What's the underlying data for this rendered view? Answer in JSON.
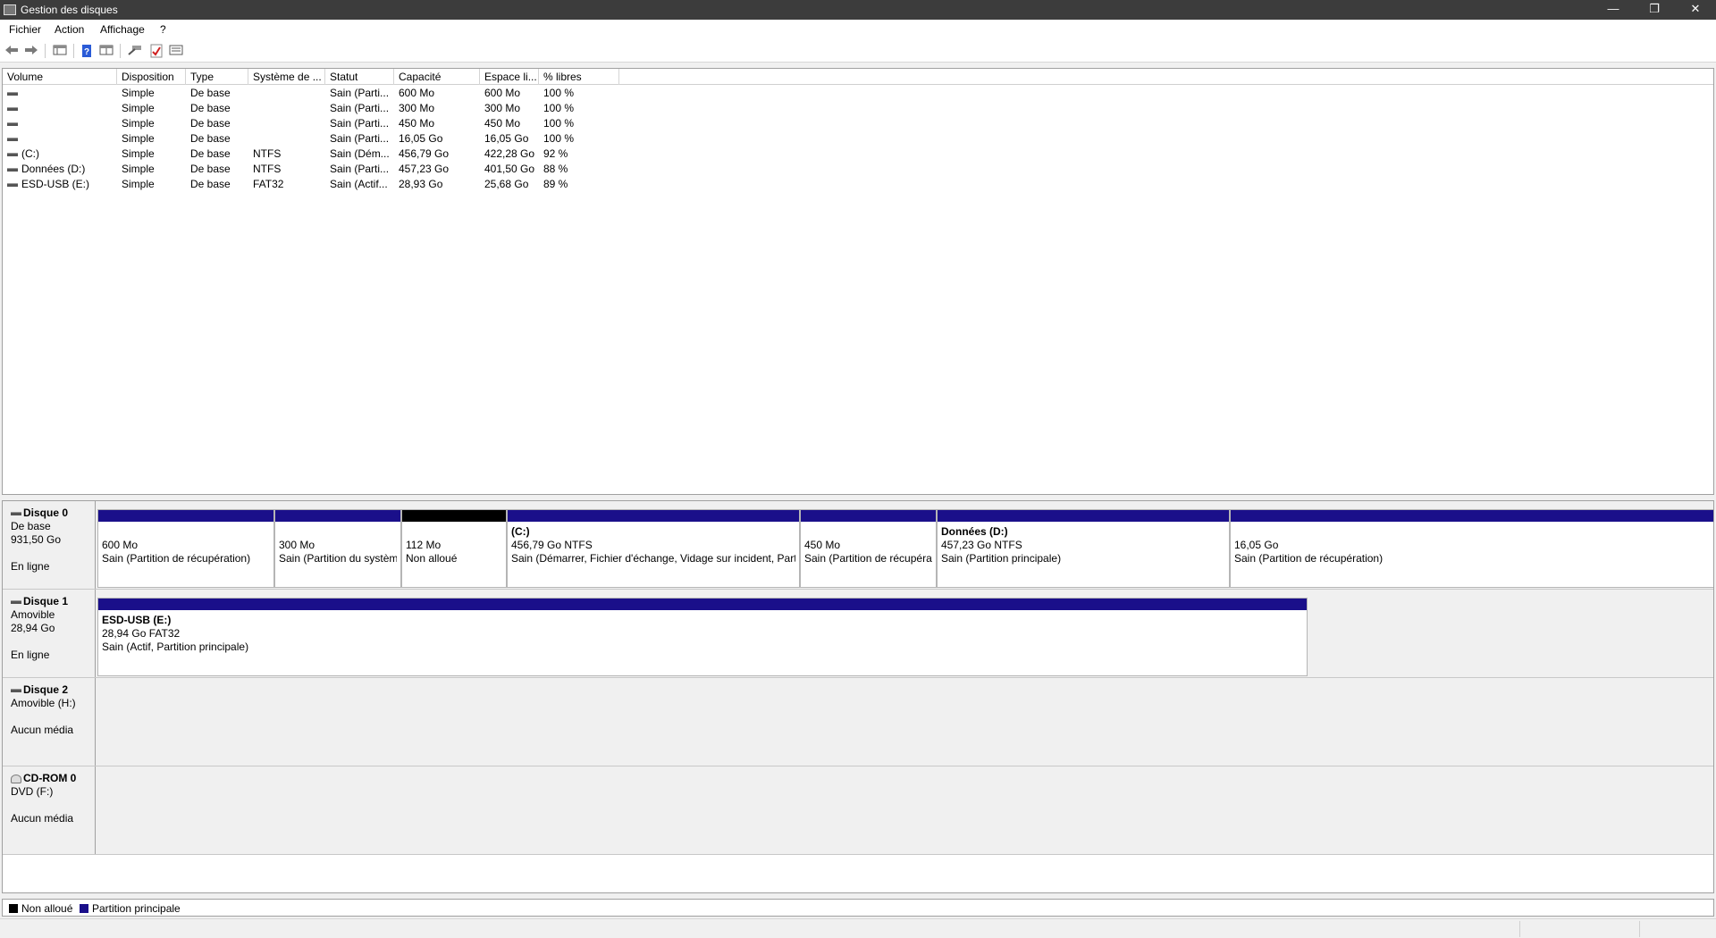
{
  "window": {
    "title": "Gestion des disques",
    "minimize_glyph": "—",
    "restore_glyph": "❐",
    "close_glyph": "✕"
  },
  "menu": [
    "Fichier",
    "Action",
    "Affichage",
    "?"
  ],
  "toolbar": {
    "icons": [
      "back-arrow-icon",
      "forward-arrow-icon",
      "console-tree-icon",
      "help-icon",
      "properties-icon",
      "connect-icon",
      "checklist-icon",
      "properties-list-icon"
    ]
  },
  "volume_list": {
    "columns": [
      "Volume",
      "Disposition",
      "Type",
      "Système de ...",
      "Statut",
      "Capacité",
      "Espace li...",
      "% libres"
    ],
    "rows": [
      {
        "volume": "",
        "layout": "Simple",
        "type": "De base",
        "fs": "",
        "status": "Sain (Parti...",
        "capacity": "600 Mo",
        "free": "600 Mo",
        "pct": "100 %"
      },
      {
        "volume": "",
        "layout": "Simple",
        "type": "De base",
        "fs": "",
        "status": "Sain (Parti...",
        "capacity": "300 Mo",
        "free": "300 Mo",
        "pct": "100 %"
      },
      {
        "volume": "",
        "layout": "Simple",
        "type": "De base",
        "fs": "",
        "status": "Sain (Parti...",
        "capacity": "450 Mo",
        "free": "450 Mo",
        "pct": "100 %"
      },
      {
        "volume": "",
        "layout": "Simple",
        "type": "De base",
        "fs": "",
        "status": "Sain (Parti...",
        "capacity": "16,05 Go",
        "free": "16,05 Go",
        "pct": "100 %"
      },
      {
        "volume": "(C:)",
        "layout": "Simple",
        "type": "De base",
        "fs": "NTFS",
        "status": "Sain (Dém...",
        "capacity": "456,79 Go",
        "free": "422,28 Go",
        "pct": "92 %"
      },
      {
        "volume": "Données (D:)",
        "layout": "Simple",
        "type": "De base",
        "fs": "NTFS",
        "status": "Sain (Parti...",
        "capacity": "457,23 Go",
        "free": "401,50 Go",
        "pct": "88 %"
      },
      {
        "volume": "ESD-USB (E:)",
        "layout": "Simple",
        "type": "De base",
        "fs": "FAT32",
        "status": "Sain (Actif...",
        "capacity": "28,93 Go",
        "free": "25,68 Go",
        "pct": "89 %"
      }
    ]
  },
  "disks": [
    {
      "name": "Disque 0",
      "line1": "De base",
      "line2": "931,50 Go",
      "line3": "",
      "line4": "En ligne",
      "partitions": [
        {
          "name": "",
          "size": "600 Mo",
          "status": "Sain (Partition de récupération)",
          "kind": "primary"
        },
        {
          "name": "",
          "size": "300 Mo",
          "status": "Sain (Partition du système EFI)",
          "kind": "primary"
        },
        {
          "name": "",
          "size": "112 Mo",
          "status": "Non alloué",
          "kind": "unallocated"
        },
        {
          "name": "(C:)",
          "size": "456,79 Go NTFS",
          "status": "Sain (Démarrer, Fichier d'échange, Vidage sur incident, Partition principale)",
          "kind": "primary"
        },
        {
          "name": "",
          "size": "450 Mo",
          "status": "Sain (Partition de récupération)",
          "kind": "primary"
        },
        {
          "name": "Données  (D:)",
          "size": "457,23 Go NTFS",
          "status": "Sain (Partition principale)",
          "kind": "primary"
        },
        {
          "name": "",
          "size": "16,05 Go",
          "status": "Sain (Partition de récupération)",
          "kind": "primary"
        }
      ]
    },
    {
      "name": "Disque 1",
      "line1": "Amovible",
      "line2": "28,94 Go",
      "line3": "",
      "line4": "En ligne",
      "partitions": [
        {
          "name": "ESD-USB  (E:)",
          "size": "28,94 Go FAT32",
          "status": "Sain (Actif, Partition principale)",
          "kind": "primary"
        }
      ]
    },
    {
      "name": "Disque 2",
      "line1": "Amovible (H:)",
      "line2": "",
      "line3": "Aucun média",
      "line4": "",
      "partitions": []
    },
    {
      "name": "CD-ROM 0",
      "line1": "DVD (F:)",
      "line2": "",
      "line3": "Aucun média",
      "line4": "",
      "partitions": []
    }
  ],
  "legend": [
    {
      "label": "Non alloué",
      "color": "#000000"
    },
    {
      "label": "Partition principale",
      "color": "#1a0f8a"
    }
  ]
}
